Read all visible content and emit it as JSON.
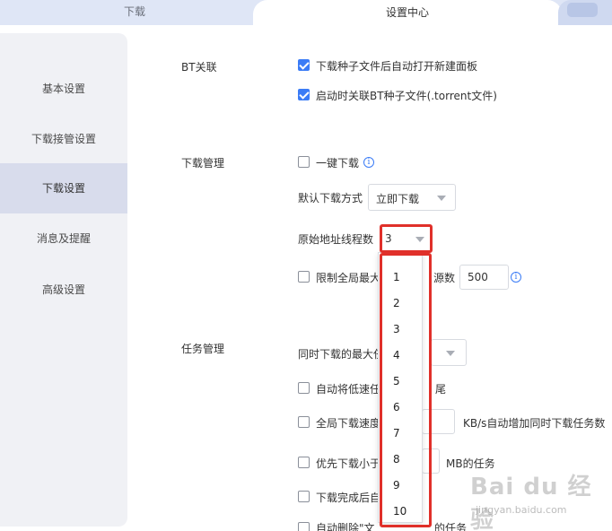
{
  "tabs": {
    "download": "下载",
    "settings": "设置中心"
  },
  "sidebar": {
    "items": [
      {
        "label": "基本设置",
        "active": false
      },
      {
        "label": "下载接管设置",
        "active": false
      },
      {
        "label": "下载设置",
        "active": true
      },
      {
        "label": "消息及提醒",
        "active": false
      },
      {
        "label": "高级设置",
        "active": false
      }
    ]
  },
  "bt": {
    "section_label": "BT关联",
    "option1": "下载种子文件后自动打开新建面板",
    "option1_checked": true,
    "option2": "启动时关联BT种子文件(.torrent文件)",
    "option2_checked": true
  },
  "download_mgmt": {
    "section_label": "下载管理",
    "one_click_label": "一键下载",
    "one_click_checked": false,
    "default_mode_label": "默认下载方式",
    "default_mode_value": "立即下载",
    "threads_label": "原始地址线程数",
    "threads_value": "3",
    "limit_label_part1": "限制全局最大",
    "limit_label_part2": "源数",
    "limit_checked": false,
    "limit_value": "500"
  },
  "task_mgmt": {
    "section_label": "任务管理",
    "max_concurrent_label": "同时下载的最大任",
    "auto_lowspeed_label": "自动将低速任",
    "auto_lowspeed_tail": "尾",
    "global_speed_label": "全局下载速度",
    "global_speed_tail": "KB/s自动增加同时下载任务数",
    "prefer_small_label": "优先下载小于",
    "prefer_small_tail": "MB的任务",
    "after_complete_label": "下载完成后自",
    "auto_delete_label": "自动删除\"文",
    "auto_delete_tail": "的任务"
  },
  "threads_dropdown": {
    "options": [
      "1",
      "2",
      "3",
      "4",
      "5",
      "6",
      "7",
      "8",
      "9",
      "10"
    ]
  },
  "watermark": {
    "logo": "Bai du 经验",
    "url": "jingyan.baidu.com"
  },
  "colors": {
    "accent": "#3b7cf6",
    "highlight": "#e0302a",
    "sidebar_bg": "#f0f1f5",
    "sidebar_active": "#d8dcec"
  }
}
